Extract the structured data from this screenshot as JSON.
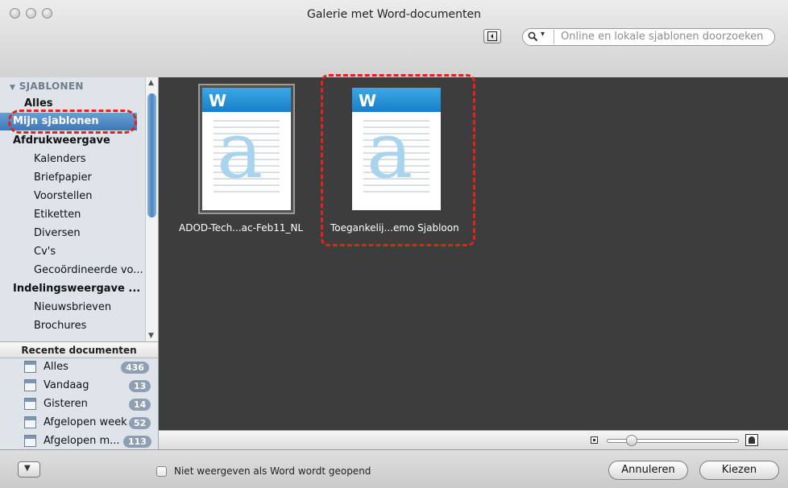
{
  "window": {
    "title": "Galerie met Word-documenten"
  },
  "search": {
    "placeholder": "Online en lokale sjablonen doorzoeken"
  },
  "sidebar": {
    "section_label": "SJABLONEN",
    "items": [
      {
        "label": "Alles",
        "bold": true,
        "indent": 1,
        "selected": false
      },
      {
        "label": "Mijn sjablonen",
        "bold": true,
        "indent": 1,
        "selected": true
      },
      {
        "label": "Afdrukweergave",
        "bold": true,
        "indent": 1,
        "selected": false
      },
      {
        "label": "Kalenders",
        "bold": false,
        "indent": 2,
        "selected": false
      },
      {
        "label": "Briefpapier",
        "bold": false,
        "indent": 2,
        "selected": false
      },
      {
        "label": "Voorstellen",
        "bold": false,
        "indent": 2,
        "selected": false
      },
      {
        "label": "Etiketten",
        "bold": false,
        "indent": 2,
        "selected": false
      },
      {
        "label": "Diversen",
        "bold": false,
        "indent": 2,
        "selected": false
      },
      {
        "label": "Cv's",
        "bold": false,
        "indent": 2,
        "selected": false
      },
      {
        "label": "Gecoördineerde vo...",
        "bold": false,
        "indent": 2,
        "selected": false
      },
      {
        "label": "Indelingsweergave ...",
        "bold": true,
        "indent": 1,
        "selected": false
      },
      {
        "label": "Nieuwsbrieven",
        "bold": false,
        "indent": 2,
        "selected": false
      },
      {
        "label": "Brochures",
        "bold": false,
        "indent": 2,
        "selected": false
      }
    ]
  },
  "recent": {
    "header": "Recente documenten",
    "items": [
      {
        "label": "Alles",
        "count": "436"
      },
      {
        "label": "Vandaag",
        "count": "13"
      },
      {
        "label": "Gisteren",
        "count": "14"
      },
      {
        "label": "Afgelopen week",
        "count": "52"
      },
      {
        "label": "Afgelopen m...",
        "count": "113"
      }
    ]
  },
  "templates": [
    {
      "name": "ADOD-Tech...ac-Feb11_NL",
      "selected": true,
      "app_letter": "W",
      "preview_letter": "a"
    },
    {
      "name": "Toegankelij...emo Sjabloon",
      "selected": false,
      "app_letter": "W",
      "preview_letter": "a",
      "highlighted": true
    }
  ],
  "footer": {
    "checkbox_label": "Niet weergeven als Word wordt geopend",
    "checkbox_checked": false,
    "cancel_label": "Annuleren",
    "choose_label": "Kiezen"
  },
  "colors": {
    "highlight": "#e0241c",
    "selection": "#3d78b8",
    "content_bg": "#3d3d3d"
  }
}
